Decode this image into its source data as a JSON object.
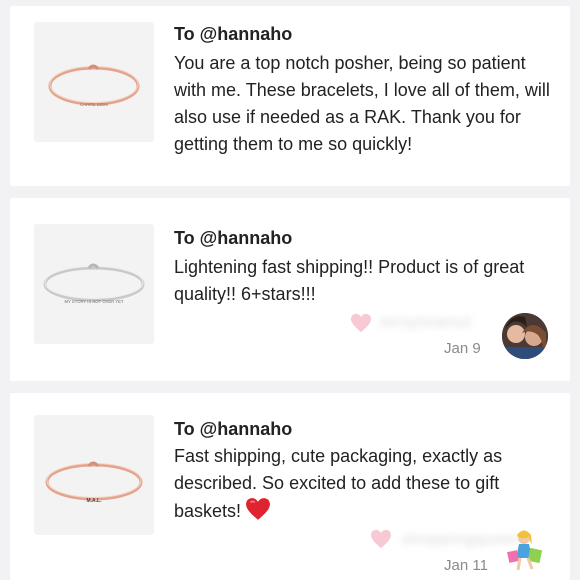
{
  "reviews": [
    {
      "to": "To @hannaho",
      "message": "You are a top notch posher, being so patient with me. These bracelets, I love all of them, will also use if needed as a RAK. Thank you for getting them to me so quickly!",
      "product_engraving": "CARPE DIEM",
      "bracelet_color": "#e3a48d",
      "product_icon": "rose-gold-bangle-icon"
    },
    {
      "to": "To @hannaho",
      "message": "Lightening fast shipping!! Product is of great quality!! 6+stars!!!",
      "product_engraving": "MY STORY IS NOT OVER YET",
      "bracelet_color": "#c9c9cc",
      "product_icon": "silver-bangle-icon",
      "reviewer_name_blurred": "mrsylvianut",
      "date": "Jan 9",
      "reviewer_avatar": "reviewer-photo-avatar"
    },
    {
      "to": "To @hannaho",
      "message": "Fast shipping, cute packaging, exactly as described. So excited to add these to gift baskets!",
      "message_emoji": "red-heart-emoji",
      "product_engraving": "M.A.L.",
      "bracelet_color": "#e3a48d",
      "product_icon": "rose-gold-bangle-icon",
      "reviewer_name_blurred": "shoppingqueen",
      "date": "Jan 11",
      "reviewer_avatar": "shopper-cartoon-avatar"
    }
  ],
  "colors": {
    "background": "#f2f2f4",
    "card": "#ffffff",
    "like_heart": "#f7c9d3",
    "emoji_heart": "#e0242f"
  }
}
